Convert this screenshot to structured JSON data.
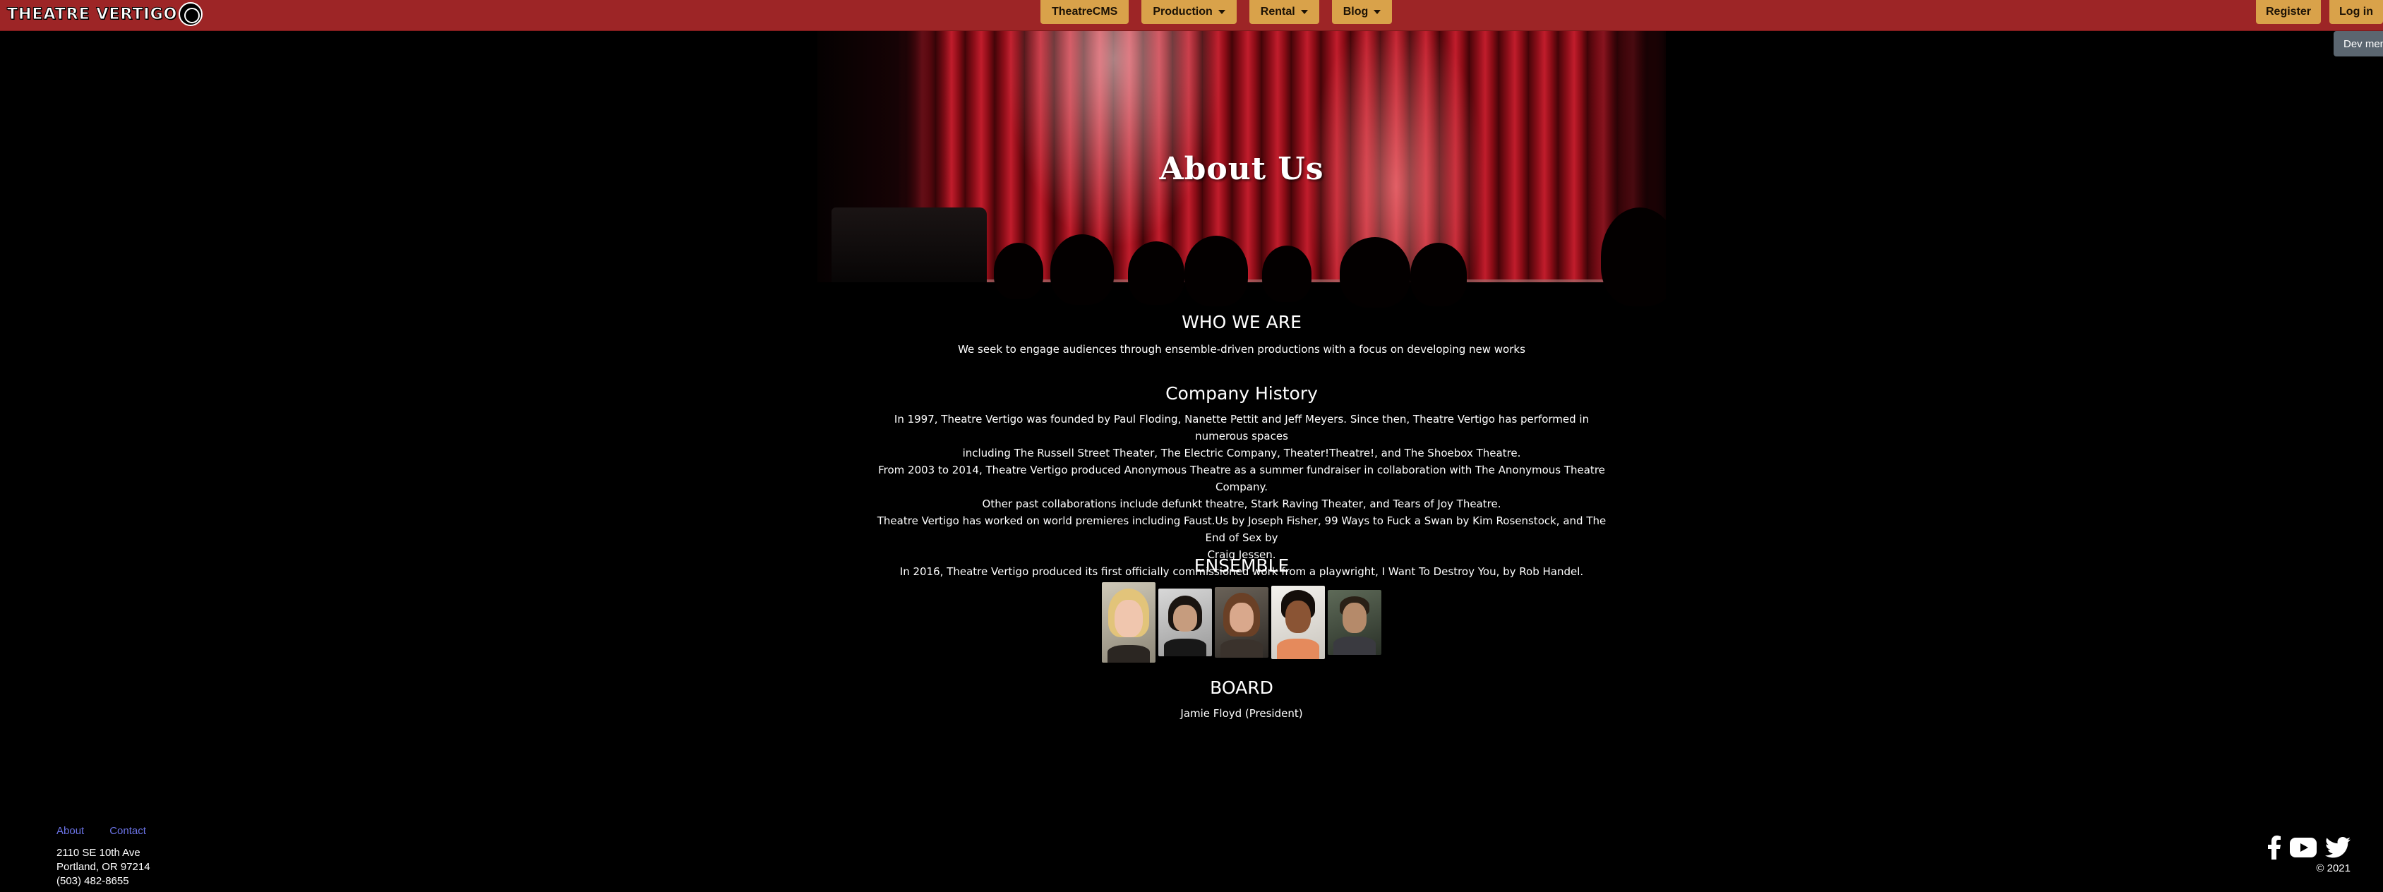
{
  "brand": {
    "name": "THEATRE VERTIGO"
  },
  "nav": {
    "items": [
      {
        "label": "TheatreCMS",
        "dropdown": false
      },
      {
        "label": "Production",
        "dropdown": true
      },
      {
        "label": "Rental",
        "dropdown": true
      },
      {
        "label": "Blog",
        "dropdown": true
      }
    ],
    "register_label": "Register",
    "login_label": "Log in",
    "dev_menu_label": "Dev menu"
  },
  "hero": {
    "title": "About Us"
  },
  "who_we_are": {
    "heading": "WHO WE ARE",
    "text": "We seek to engage audiences through ensemble-driven productions with a focus on developing new works"
  },
  "company_history": {
    "heading": "Company History",
    "lines": [
      "In 1997, Theatre Vertigo was founded by Paul Floding, Nanette Pettit and Jeff Meyers. Since then, Theatre Vertigo has performed in numerous spaces",
      "including The Russell Street Theater, The Electric Company, Theater!Theatre!, and The Shoebox Theatre.",
      "From 2003 to 2014, Theatre Vertigo produced Anonymous Theatre as a summer fundraiser in collaboration with The Anonymous Theatre Company.",
      "Other past collaborations include defunkt theatre, Stark Raving Theater, and Tears of Joy Theatre.",
      "Theatre Vertigo has worked on world premieres including Faust.Us by Joseph Fisher, 99 Ways to Fuck a Swan by Kim Rosenstock, and The End of Sex by",
      "Craig Jessen.",
      "In 2016, Theatre Vertigo produced its first officially commissioned work from a playwright, I Want To Destroy You, by Rob Handel."
    ]
  },
  "ensemble": {
    "heading": "ENSEMBLE",
    "members": [
      {
        "photo": "ensemble-member-photo-1"
      },
      {
        "photo": "ensemble-member-photo-2"
      },
      {
        "photo": "ensemble-member-photo-3"
      },
      {
        "photo": "ensemble-member-photo-4"
      },
      {
        "photo": "ensemble-member-photo-5"
      }
    ]
  },
  "board": {
    "heading": "BOARD",
    "members": [
      "Jamie Floyd (President)"
    ]
  },
  "footer": {
    "links": [
      "About",
      "Contact"
    ],
    "address_line1": "2110 SE 10th Ave",
    "address_line2": "Portland, OR 97214",
    "phone": "(503) 482-8655",
    "social_icons": [
      "facebook-icon",
      "youtube-icon",
      "twitter-icon"
    ],
    "copyright": "© 2021"
  },
  "colors": {
    "navbar_bg": "#9d2526",
    "nav_button_bg": "#d9a24a",
    "page_bg": "#000000",
    "footer_link": "#6c74e8",
    "dev_menu_bg": "#5b6670"
  }
}
